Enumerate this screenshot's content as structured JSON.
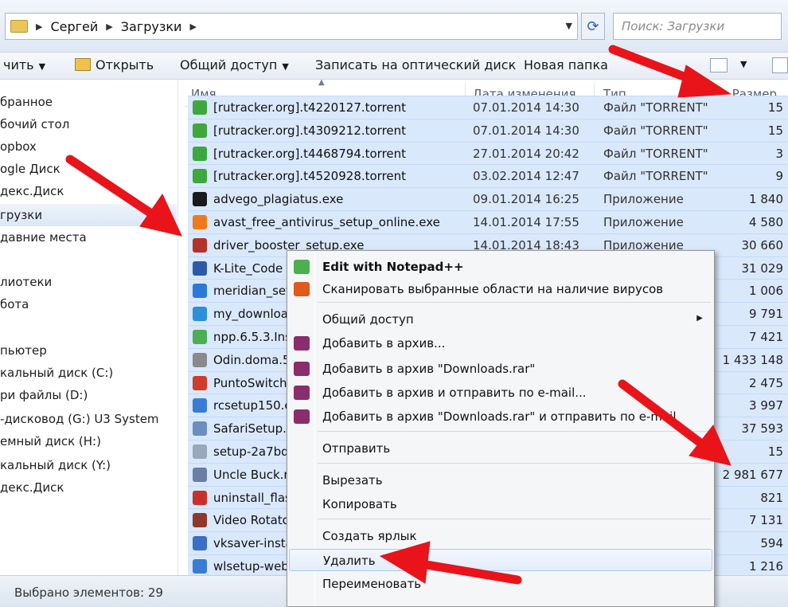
{
  "address": {
    "crumbs": [
      "Сергей",
      "Загрузки"
    ],
    "search_placeholder": "Поиск: Загрузки"
  },
  "toolbar": {
    "organize_label": "чить",
    "open_label": "Открыть",
    "share_label": "Общий доступ",
    "burn_label": "Записать на оптический диск",
    "new_folder_label": "Новая папка"
  },
  "nav": {
    "items": [
      {
        "label": "бранное"
      },
      {
        "label": "бочий стол"
      },
      {
        "label": "opbox"
      },
      {
        "label": "ogle Диск"
      },
      {
        "label": "декс.Диск"
      },
      {
        "label": "грузки",
        "selected": true
      },
      {
        "label": "давние места"
      },
      {
        "label": ""
      },
      {
        "label": "лиотеки"
      },
      {
        "label": "бота"
      },
      {
        "label": ""
      },
      {
        "label": "пьютер"
      },
      {
        "label": "кальный диск (C:)"
      },
      {
        "label": "ри файлы (D:)"
      },
      {
        "label": "-дисковод (G:) U3 System"
      },
      {
        "label": "емный диск (H:)"
      },
      {
        "label": "кальный диск (Y:)"
      },
      {
        "label": "декс.Диск"
      }
    ]
  },
  "columns": {
    "name": "Имя",
    "date": "Дата изменения",
    "type": "Тип",
    "size": "Размер"
  },
  "files": [
    {
      "name": "[rutracker.org].t4220127.torrent",
      "date": "07.01.2014 14:30",
      "type": "Файл \"TORRENT\"",
      "size": "15",
      "icon_color": "#3da83d"
    },
    {
      "name": "[rutracker.org].t4309212.torrent",
      "date": "07.01.2014 14:30",
      "type": "Файл \"TORRENT\"",
      "size": "15",
      "icon_color": "#3da83d"
    },
    {
      "name": "[rutracker.org].t4468794.torrent",
      "date": "27.01.2014 20:42",
      "type": "Файл \"TORRENT\"",
      "size": "3",
      "icon_color": "#3da83d"
    },
    {
      "name": "[rutracker.org].t4520928.torrent",
      "date": "03.02.2014 12:47",
      "type": "Файл \"TORRENT\"",
      "size": "9",
      "icon_color": "#3da83d"
    },
    {
      "name": "advego_plagiatus.exe",
      "date": "09.01.2014 16:25",
      "type": "Приложение",
      "size": "1 840",
      "icon_color": "#1a1a1a"
    },
    {
      "name": "avast_free_antivirus_setup_online.exe",
      "date": "14.01.2014 17:55",
      "type": "Приложение",
      "size": "4 580",
      "icon_color": "#f07a1a"
    },
    {
      "name": "driver_booster_setup.exe",
      "date": "14.01.2014 18:43",
      "type": "Приложение",
      "size": "30 660",
      "icon_color": "#b4322a"
    },
    {
      "name": "K-Lite_Code",
      "date": "",
      "type": "",
      "size": "31 029",
      "icon_color": "#2d5aa8"
    },
    {
      "name": "meridian_set",
      "date": "",
      "type": "",
      "size": "1 006",
      "icon_color": "#2b7bd6"
    },
    {
      "name": "my_downloa",
      "date": "",
      "type": "",
      "size": "9 791",
      "icon_color": "#2c8fd8"
    },
    {
      "name": "npp.6.5.3.Ins",
      "date": "",
      "type": "",
      "size": "7 421",
      "icon_color": "#4caf50"
    },
    {
      "name": "Odin.doma.5",
      "date": "",
      "type": "",
      "size": "1 433 148",
      "icon_color": "#8a8a8a"
    },
    {
      "name": "PuntoSwitch",
      "date": "",
      "type": "",
      "size": "2 475",
      "icon_color": "#d23a2a"
    },
    {
      "name": "rcsetup150.e",
      "date": "",
      "type": "",
      "size": "3 997",
      "icon_color": "#3a7bd5"
    },
    {
      "name": "SafariSetup.e",
      "date": "",
      "type": "",
      "size": "37 593",
      "icon_color": "#6a8fbf"
    },
    {
      "name": "setup-2a7bd",
      "date": "",
      "type": "",
      "size": "15",
      "icon_color": "#9aa8bb"
    },
    {
      "name": "Uncle Buck.r",
      "date": "",
      "type": "",
      "size": "2 981 677",
      "icon_color": "#6a7fa3"
    },
    {
      "name": "uninstall_flas",
      "date": "",
      "type": "",
      "size": "821",
      "icon_color": "#c9302c"
    },
    {
      "name": "Video Rotato",
      "date": "",
      "type": "",
      "size": "7 131",
      "icon_color": "#8e3a2a"
    },
    {
      "name": "vksaver-insta",
      "date": "",
      "type": "",
      "size": "594",
      "icon_color": "#3a6fc5"
    },
    {
      "name": "wlsetup-web",
      "date": "",
      "type": "",
      "size": "1 216",
      "icon_color": "#3a7bd5"
    }
  ],
  "status": {
    "selected_text": "Выбрано элементов: 29"
  },
  "context_menu": {
    "items": [
      {
        "label": "Edit with Notepad++",
        "bold": true,
        "icon_color": "#4caf50"
      },
      {
        "label": "Сканировать выбранные области на наличие вирусов",
        "icon_color": "#e05a1a"
      },
      {
        "label": "Общий доступ",
        "submenu": true
      },
      {
        "label": "Добавить в архив...",
        "icon_color": "#8a2d6d"
      },
      {
        "label": "Добавить в архив \"Downloads.rar\"",
        "icon_color": "#8a2d6d"
      },
      {
        "label": "Добавить в архив и отправить по e-mail...",
        "icon_color": "#8a2d6d"
      },
      {
        "label": "Добавить в архив \"Downloads.rar\" и отправить по e-mail",
        "icon_color": "#8a2d6d"
      },
      {
        "label": "Отправить",
        "submenu": true
      },
      {
        "label": "Вырезать"
      },
      {
        "label": "Копировать"
      },
      {
        "label": "Создать ярлык"
      },
      {
        "label": "Удалить",
        "highlighted": true
      },
      {
        "label": "Переименовать"
      }
    ]
  },
  "colors": {
    "selection": "#d9e8fb",
    "arrow": "#e8141a"
  }
}
